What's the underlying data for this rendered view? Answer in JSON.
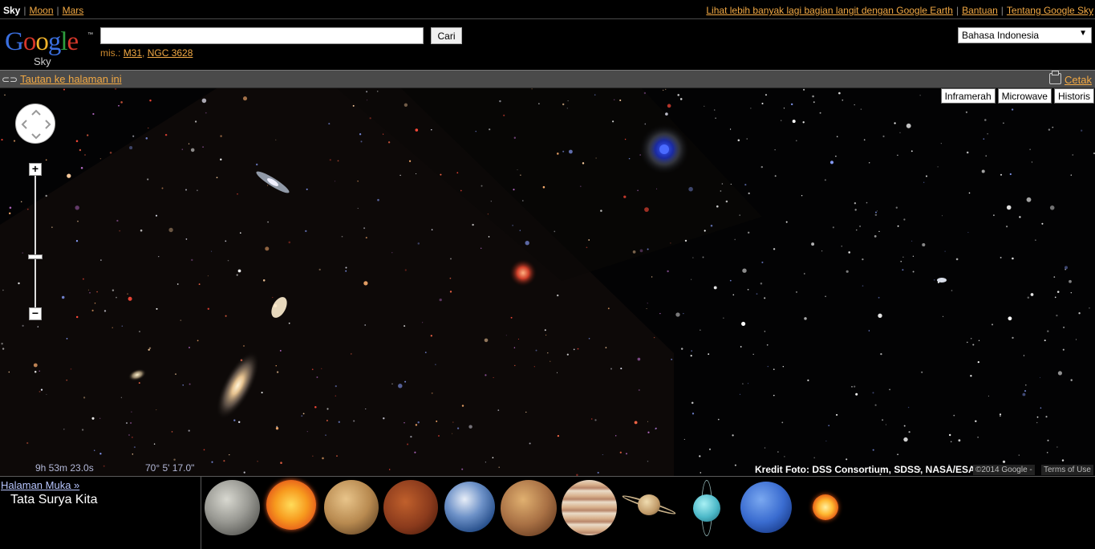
{
  "topbar": {
    "sky": "Sky",
    "moon": "Moon",
    "mars": "Mars",
    "earth_link": "Lihat lebih banyak lagi bagian langit dengan Google Earth",
    "help": "Bantuan",
    "about": "Tentang Google Sky"
  },
  "logo": {
    "word": "Google",
    "tm": "™",
    "product": "Sky"
  },
  "search": {
    "value": "",
    "button": "Cari",
    "examples_prefix": "mis.:",
    "example1": "M31",
    "example2": "NGC 3628"
  },
  "language": {
    "selected": "Bahasa Indonesia"
  },
  "linkbar": {
    "permalink": "Tautan ke halaman ini",
    "print": "Cetak"
  },
  "layers": [
    "Inframerah",
    "Microwave",
    "Historis"
  ],
  "zoom": {
    "plus": "+",
    "minus": "−"
  },
  "coords": {
    "ra": "9h 53m 23.0s",
    "dec": "70° 5' 17.0\""
  },
  "credit": "Kredit Foto: DSS Consortium, SDSS, NASA/ESA",
  "copyright": "©2014 Google -",
  "terms": "Terms of Use",
  "panel": {
    "home": "Halaman Muka »",
    "title": "Tata Surya Kita",
    "planets": [
      "moon",
      "sun",
      "mercury",
      "venus",
      "earth",
      "mars",
      "jupiter",
      "saturn",
      "uranus",
      "neptune",
      "pluto"
    ]
  },
  "colors": {
    "link": "#f2a944",
    "bar": "#4a4a4a",
    "coords": "#b3b8d8"
  }
}
